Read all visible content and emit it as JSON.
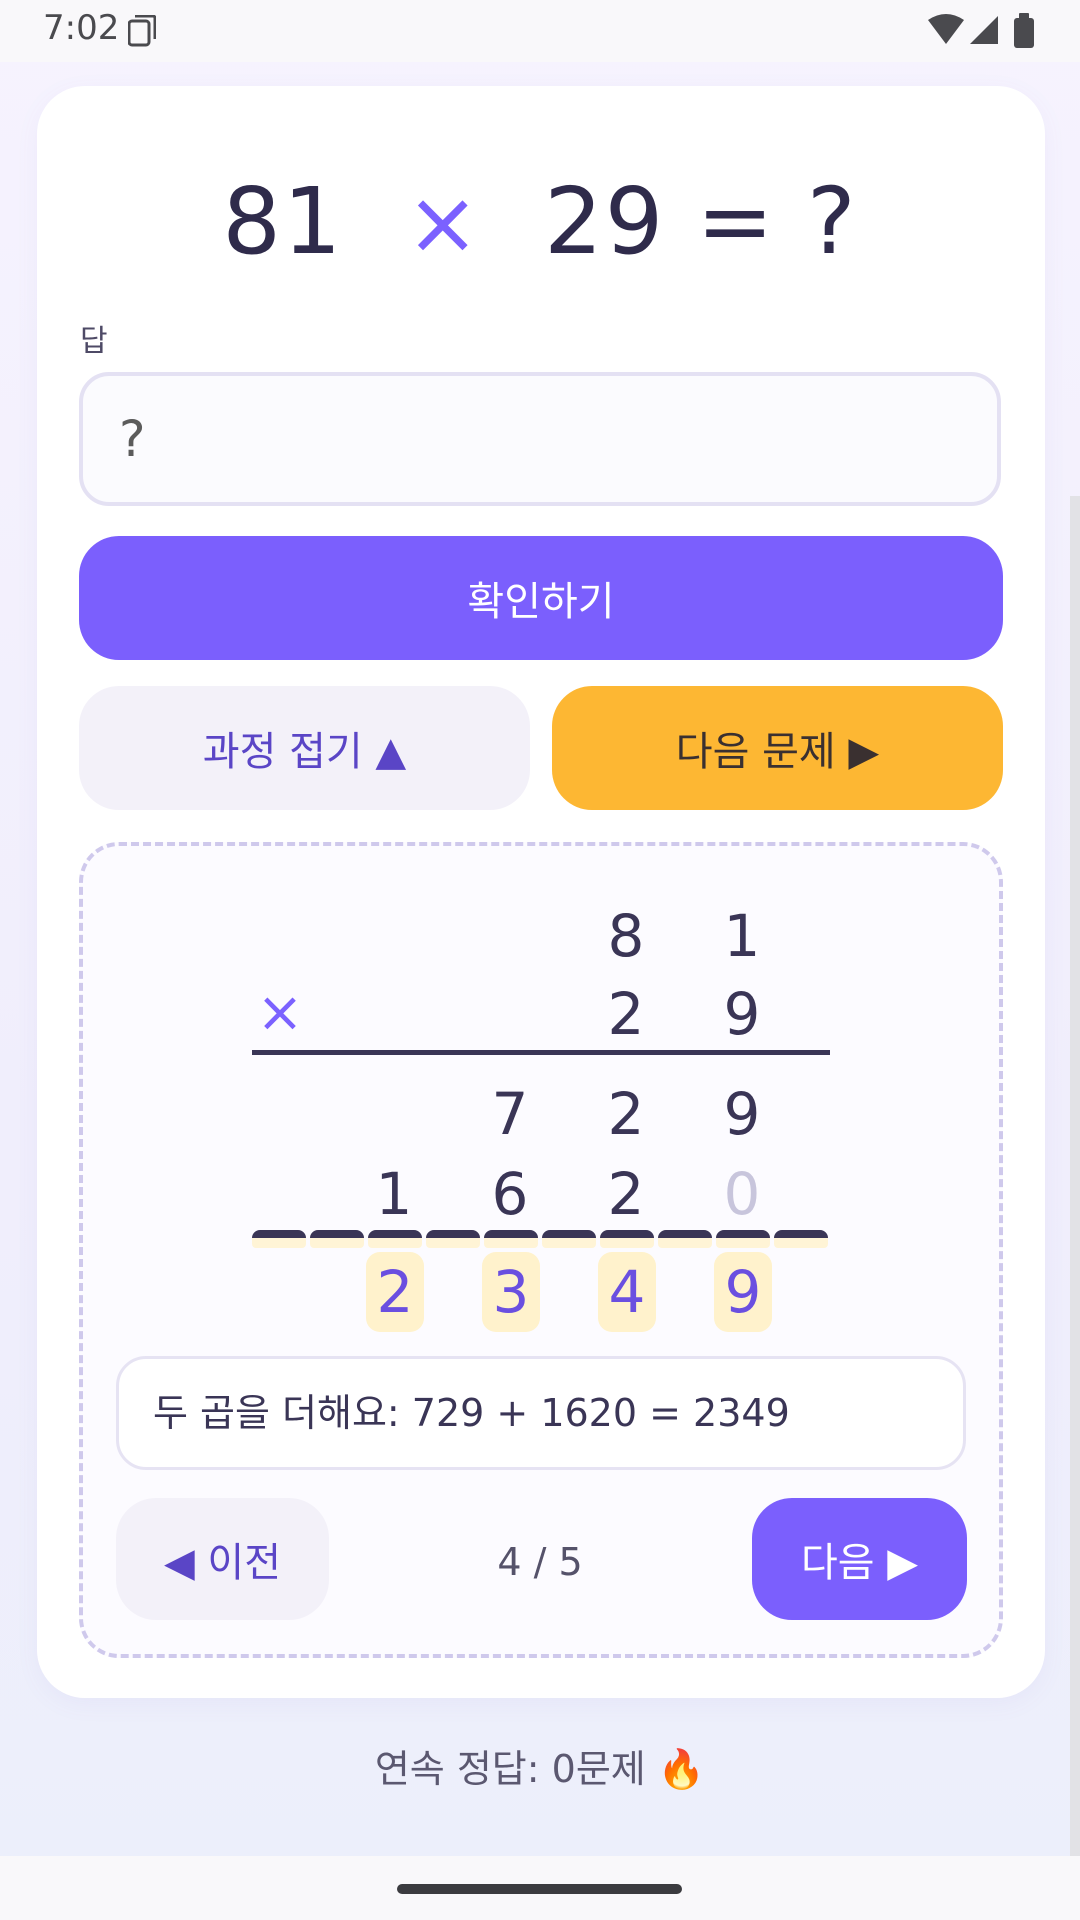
{
  "status": {
    "time": "7:02"
  },
  "problem": {
    "a": "81",
    "op": "×",
    "b": "29",
    "rest": "= ?"
  },
  "answer": {
    "label": "답",
    "placeholder": "?",
    "value": ""
  },
  "buttons": {
    "check": "확인하기",
    "collapse": "과정 접기 ▲",
    "next_problem": "다음 문제 ▶"
  },
  "process": {
    "row1": [
      "8",
      "1"
    ],
    "times": "×",
    "row2": [
      "2",
      "9"
    ],
    "partial1": [
      "7",
      "2",
      "9"
    ],
    "partial2": [
      "1",
      "6",
      "2",
      "0"
    ],
    "result": [
      "2",
      "3",
      "4",
      "9"
    ],
    "explanation": "두 곱을 더해요: 729 + 1620 = 2349",
    "prev_label": "◀ 이전",
    "next_label": "다음 ▶",
    "page": "4 / 5"
  },
  "streak": "연속 정답: 0문제 🔥",
  "colors": {
    "accent": "#7b5ffd",
    "warning": "#fdb733",
    "highlight": "#fff2cc",
    "ink": "#3a3556"
  }
}
